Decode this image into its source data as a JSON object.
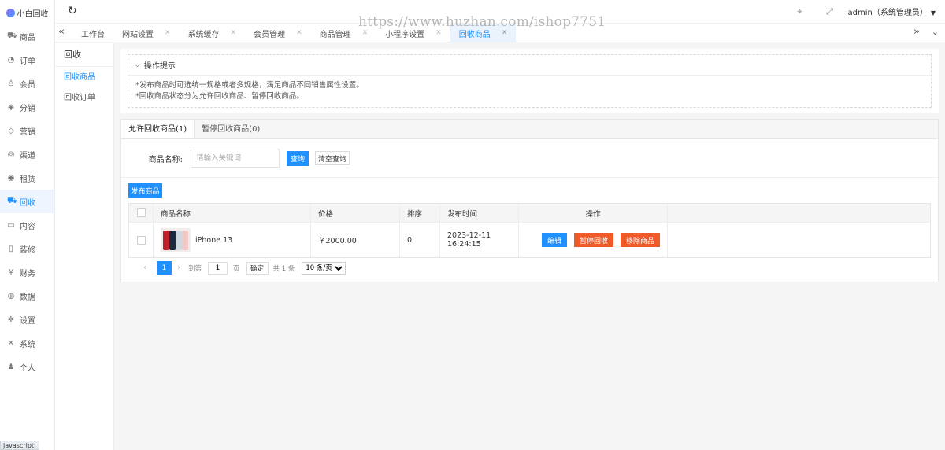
{
  "app": {
    "logo_text": "小白回收",
    "status_text": "javascript:"
  },
  "watermark": "https://www.huzhan.com/ishop7751",
  "colors": {
    "accent": "#1e90ff",
    "danger": "#f05a28"
  },
  "nav": {
    "items": [
      {
        "label": "商品",
        "icon": "cart-icon"
      },
      {
        "label": "订单",
        "icon": "bell-icon"
      },
      {
        "label": "会员",
        "icon": "user-icon"
      },
      {
        "label": "分销",
        "icon": "layers-icon"
      },
      {
        "label": "营销",
        "icon": "diamond-icon"
      },
      {
        "label": "渠道",
        "icon": "coin-icon"
      },
      {
        "label": "租赁",
        "icon": "shield-icon"
      },
      {
        "label": "回收",
        "icon": "cart-icon",
        "active": true
      },
      {
        "label": "内容",
        "icon": "book-icon"
      },
      {
        "label": "装修",
        "icon": "phone-icon"
      },
      {
        "label": "财务",
        "icon": "yen-icon"
      },
      {
        "label": "数据",
        "icon": "globe-icon"
      },
      {
        "label": "设置",
        "icon": "gear-icon"
      },
      {
        "label": "系统",
        "icon": "tools-icon"
      },
      {
        "label": "个人",
        "icon": "person-icon"
      }
    ]
  },
  "header": {
    "user_label": "admin（系统管理员）"
  },
  "tabs": [
    {
      "label": "工作台",
      "closable": false
    },
    {
      "label": "网站设置",
      "closable": true
    },
    {
      "label": "系统缓存",
      "closable": true
    },
    {
      "label": "会员管理",
      "closable": true
    },
    {
      "label": "商品管理",
      "closable": true
    },
    {
      "label": "小程序设置",
      "closable": true
    },
    {
      "label": "回收商品",
      "closable": true,
      "active": true
    }
  ],
  "subnav": {
    "title": "回收",
    "items": [
      {
        "label": "回收商品",
        "active": true
      },
      {
        "label": "回收订单"
      }
    ]
  },
  "tips": {
    "title": "操作提示",
    "lines": [
      "*发布商品时可选统一规格或者多规格，满足商品不同销售属性设置。",
      "*回收商品状态分为允许回收商品、暂停回收商品。"
    ]
  },
  "subtabs": [
    {
      "label": "允许回收商品(1)",
      "active": true
    },
    {
      "label": "暂停回收商品(0)"
    }
  ],
  "search": {
    "label": "商品名称:",
    "placeholder": "请输入关键词",
    "query_label": "查询",
    "clear_label": "清空查询"
  },
  "toolbar": {
    "publish_label": "发布商品"
  },
  "table": {
    "headers": {
      "name": "商品名称",
      "price": "价格",
      "sort": "排序",
      "time": "发布时间",
      "op": "操作"
    },
    "rows": [
      {
        "name": "iPhone 13",
        "price": "￥2000.00",
        "sort": "0",
        "time": "2023-12-11 16:24:15",
        "actions": {
          "edit": "编辑",
          "pause": "暂停回收",
          "remove": "移除商品"
        }
      }
    ]
  },
  "pager": {
    "current": "1",
    "goto_label": "到第",
    "goto_value": "1",
    "page_unit": "页",
    "confirm_label": "确定",
    "total_label": "共 1 条",
    "page_size_label": "10 条/页"
  }
}
